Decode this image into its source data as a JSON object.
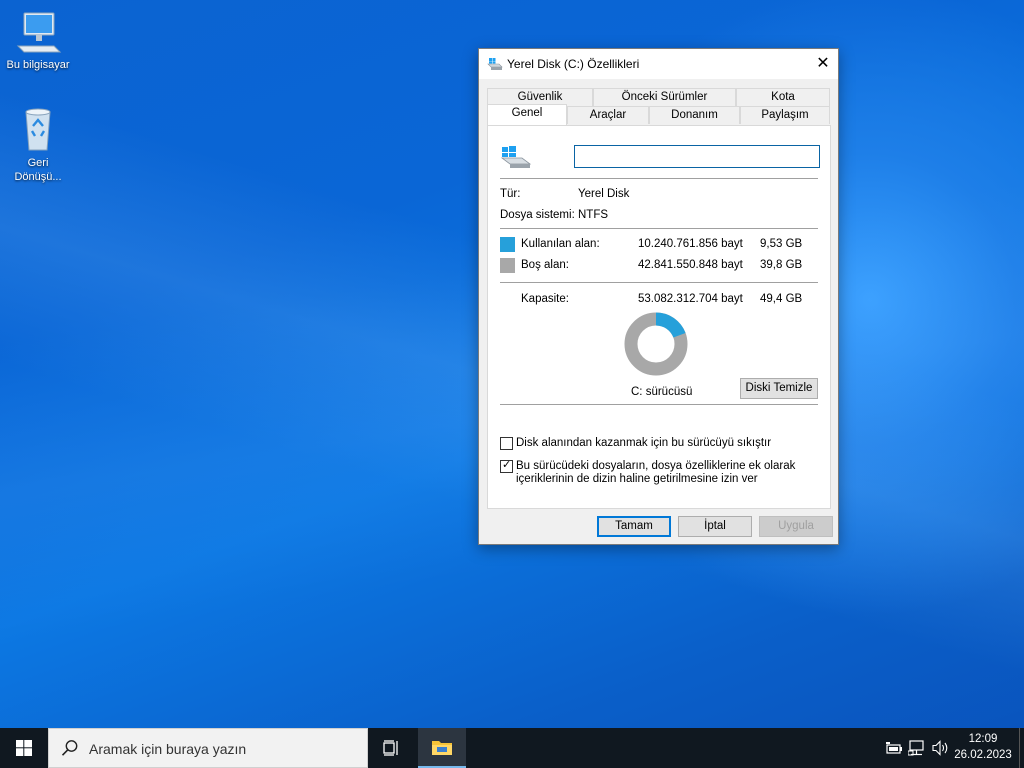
{
  "desktop": {
    "icons": [
      {
        "label": "Bu bilgisayar"
      },
      {
        "label_line1": "Geri",
        "label_line2": "Dönüşü..."
      }
    ]
  },
  "dialog": {
    "title": "Yerel Disk (C:) Özellikleri",
    "close_glyph": "✕",
    "tabs_top": [
      "Güvenlik",
      "Önceki Sürümler",
      "Kota"
    ],
    "tabs_bottom": [
      "Genel",
      "Araçlar",
      "Donanım",
      "Paylaşım"
    ],
    "active_tab": "Genel",
    "drive_name_value": "",
    "type_label": "Tür:",
    "type_value": "Yerel Disk",
    "fs_label": "Dosya sistemi:",
    "fs_value": "NTFS",
    "used": {
      "label": "Kullanılan alan:",
      "bytes": "10.240.761.856 bayt",
      "size": "9,53 GB",
      "color": "#26a0da"
    },
    "free": {
      "label": "Boş alan:",
      "bytes": "42.841.550.848 bayt",
      "size": "39,8 GB",
      "color": "#a8a8a8"
    },
    "capacity": {
      "label": "Kapasite:",
      "bytes": "53.082.312.704 bayt",
      "size": "49,4 GB"
    },
    "used_fraction": 0.193,
    "drive_caption": "C: sürücüsü",
    "cleanup_button": "Diski Temizle",
    "compress_label": "Disk alanından kazanmak için bu sürücüyü sıkıştır",
    "compress_checked": false,
    "index_label_line1": "Bu sürücüdeki dosyaların, dosya özelliklerine ek olarak",
    "index_label_line2": "içeriklerinin de dizin haline getirilmesine izin ver",
    "index_checked": true,
    "check_glyph": "✓",
    "ok_button": "Tamam",
    "cancel_button": "İptal",
    "apply_button": "Uygula"
  },
  "taskbar": {
    "search_placeholder": "Aramak için buraya yazın",
    "time": "12:09",
    "date": "26.02.2023",
    "accent": "#76b9ed"
  }
}
